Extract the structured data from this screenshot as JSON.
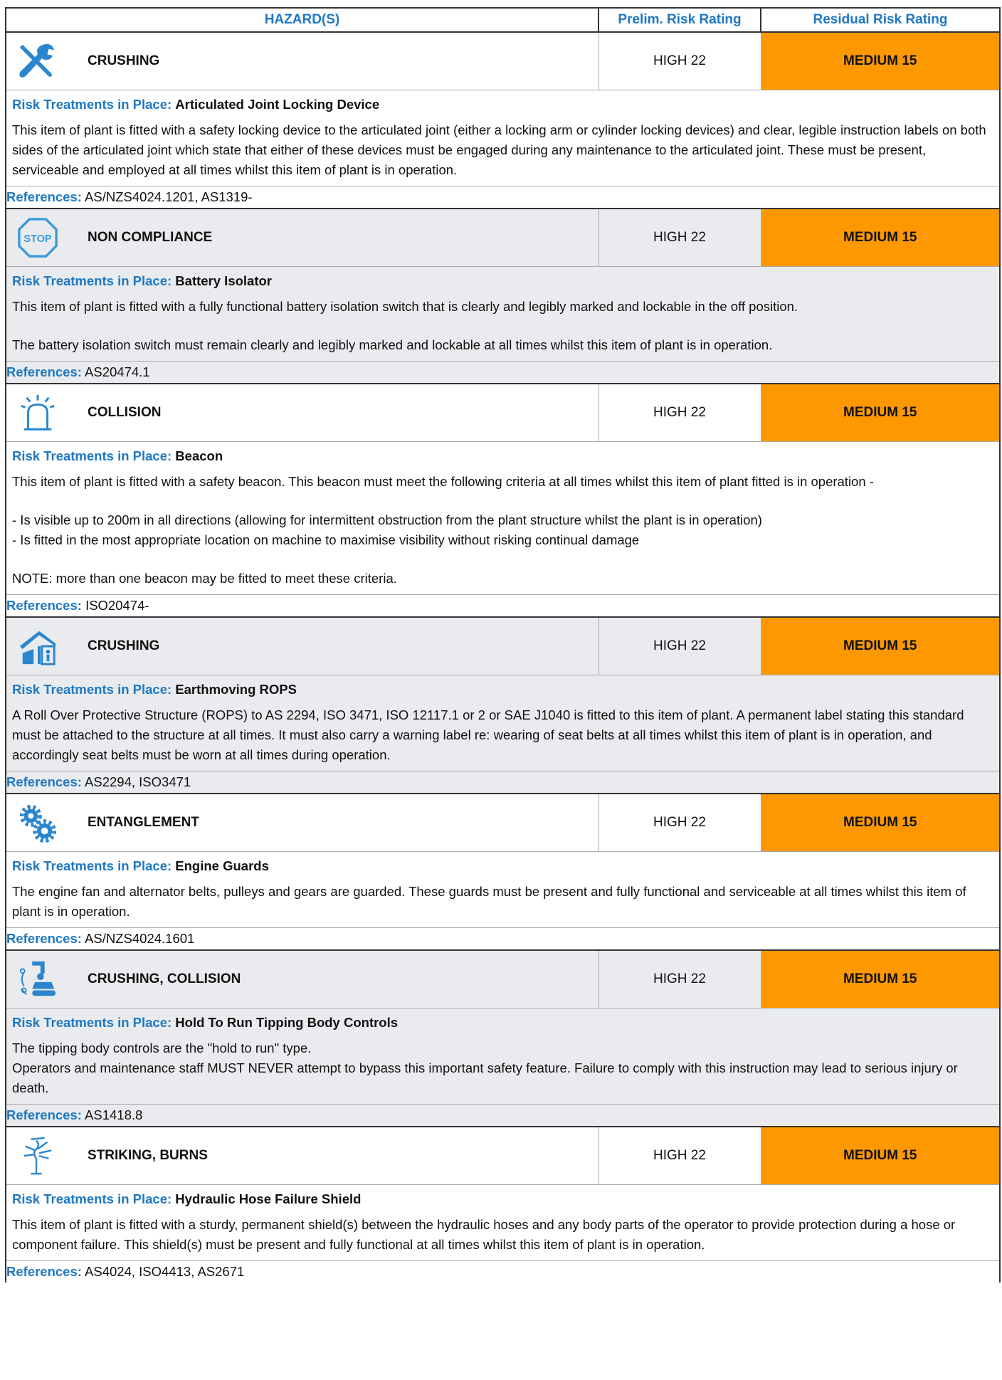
{
  "header": {
    "hazards": "HAZARD(S)",
    "prelim": "Prelim. Risk Rating",
    "residual": "Residual Risk Rating"
  },
  "labels": {
    "treatments": "Risk Treatments in Place:",
    "references": "References:"
  },
  "colors": {
    "accent_blue": "#1e78c2",
    "rating_orange": "#fd9800",
    "shade_gray": "#e9ebee"
  },
  "items": [
    {
      "icon": "tools-crossed-icon",
      "hazard": "CRUSHING",
      "prelim": "HIGH 22",
      "residual": "MEDIUM 15",
      "treatment": "Articulated Joint Locking Device",
      "paragraphs": [
        "This item of plant is fitted with a safety locking device to the articulated joint (either a locking arm or cylinder locking devices) and clear, legible instruction labels on both sides of the articulated joint which state that either of these devices must be engaged during any maintenance to the articulated joint. These must be present, serviceable and employed at all times whilst this item of plant is in operation."
      ],
      "references": "AS/NZS4024.1201, AS1319-"
    },
    {
      "icon": "stop-sign-icon",
      "hazard": "NON COMPLIANCE",
      "prelim": "HIGH 22",
      "residual": "MEDIUM 15",
      "treatment": "Battery Isolator",
      "paragraphs": [
        "This item of plant is fitted with a fully functional battery isolation switch that is clearly and legibly marked and lockable in the off position.",
        "The battery isolation switch must remain clearly and legibly marked and lockable at all times whilst this item of plant is in operation."
      ],
      "references": "AS20474.1"
    },
    {
      "icon": "beacon-icon",
      "hazard": "COLLISION",
      "prelim": "HIGH 22",
      "residual": "MEDIUM 15",
      "treatment": "Beacon",
      "paragraphs": [
        "This item of plant is fitted with a safety beacon. This beacon must meet the following criteria at all times whilst this item of plant fitted is in operation -",
        "- Is visible up to 200m in all directions (allowing for intermittent obstruction from the plant structure whilst the plant is in operation)\n- Is fitted in the most appropriate location on machine to maximise visibility without risking continual damage",
        "NOTE: more than one beacon may be fitted to meet these criteria."
      ],
      "references": "ISO20474-"
    },
    {
      "icon": "rops-cab-icon",
      "hazard": "CRUSHING",
      "prelim": "HIGH 22",
      "residual": "MEDIUM 15",
      "treatment": "Earthmoving ROPS",
      "paragraphs": [
        "A Roll Over Protective Structure (ROPS) to AS 2294, ISO 3471, ISO 12117.1 or 2 or SAE J1040 is fitted to this item of plant. A permanent label stating this standard must be attached to the structure at all times. It must also carry a warning label re: wearing of seat belts at all times whilst this item of plant is in operation, and accordingly seat belts must be worn at all times during operation."
      ],
      "references": "AS2294, ISO3471"
    },
    {
      "icon": "gears-icon",
      "hazard": "ENTANGLEMENT",
      "prelim": "HIGH 22",
      "residual": "MEDIUM 15",
      "treatment": "Engine Guards",
      "paragraphs": [
        "The engine fan and alternator belts, pulleys and gears are guarded. These guards must be present and fully functional and serviceable at all times whilst this item of plant is in operation."
      ],
      "references": "AS/NZS4024.1601"
    },
    {
      "icon": "excavator-operator-icon",
      "hazard": "CRUSHING, COLLISION",
      "prelim": "HIGH 22",
      "residual": "MEDIUM 15",
      "treatment": "Hold To Run Tipping Body Controls",
      "paragraphs": [
        "The tipping body controls are the \"hold to run\" type.\nOperators and maintenance staff MUST NEVER attempt to bypass this important safety feature. Failure to comply with this instruction may lead to serious injury or death."
      ],
      "references": "AS1418.8"
    },
    {
      "icon": "hose-burst-icon",
      "hazard": "STRIKING, BURNS",
      "prelim": "HIGH 22",
      "residual": "MEDIUM 15",
      "treatment": "Hydraulic Hose Failure Shield",
      "paragraphs": [
        "This item of plant is fitted with a sturdy, permanent shield(s) between the hydraulic hoses and any body parts of the operator to provide protection during a hose or component failure. This shield(s) must be present and fully functional at all times whilst this item of plant is in operation."
      ],
      "references": "AS4024, ISO4413, AS2671"
    }
  ]
}
